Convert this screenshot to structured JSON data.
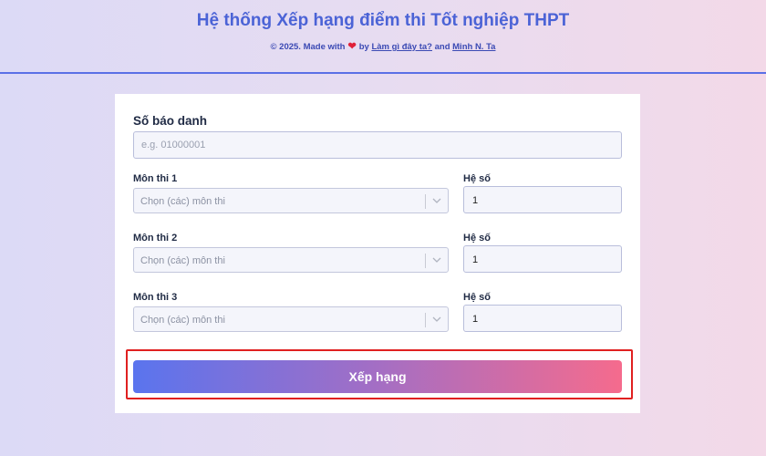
{
  "header": {
    "title": "Hệ thống Xếp hạng điểm thi Tốt nghiệp THPT",
    "credit_prefix": "© 2025. Made with",
    "credit_by": "by",
    "credit_link1": "Làm gì đây ta?",
    "credit_and": "and",
    "credit_link2": "Minh N. Ta",
    "heart_icon": "heart-icon"
  },
  "form": {
    "sbd_label": "Số báo danh",
    "sbd_placeholder": "e.g. 01000001",
    "rows": [
      {
        "subject_label": "Môn thi 1",
        "subject_placeholder": "Chọn (các) môn thi",
        "coef_label": "Hệ số",
        "coef_value": "1"
      },
      {
        "subject_label": "Môn thi 2",
        "subject_placeholder": "Chọn (các) môn thi",
        "coef_label": "Hệ số",
        "coef_value": "1"
      },
      {
        "subject_label": "Môn thi 3",
        "subject_placeholder": "Chọn (các) môn thi",
        "coef_label": "Hệ số",
        "coef_value": "1"
      }
    ],
    "submit_label": "Xếp hạng"
  },
  "colors": {
    "accent": "#4b63d6",
    "button_start": "#5a74ee",
    "button_end": "#f56b8d",
    "highlight_outline": "#e02020"
  }
}
